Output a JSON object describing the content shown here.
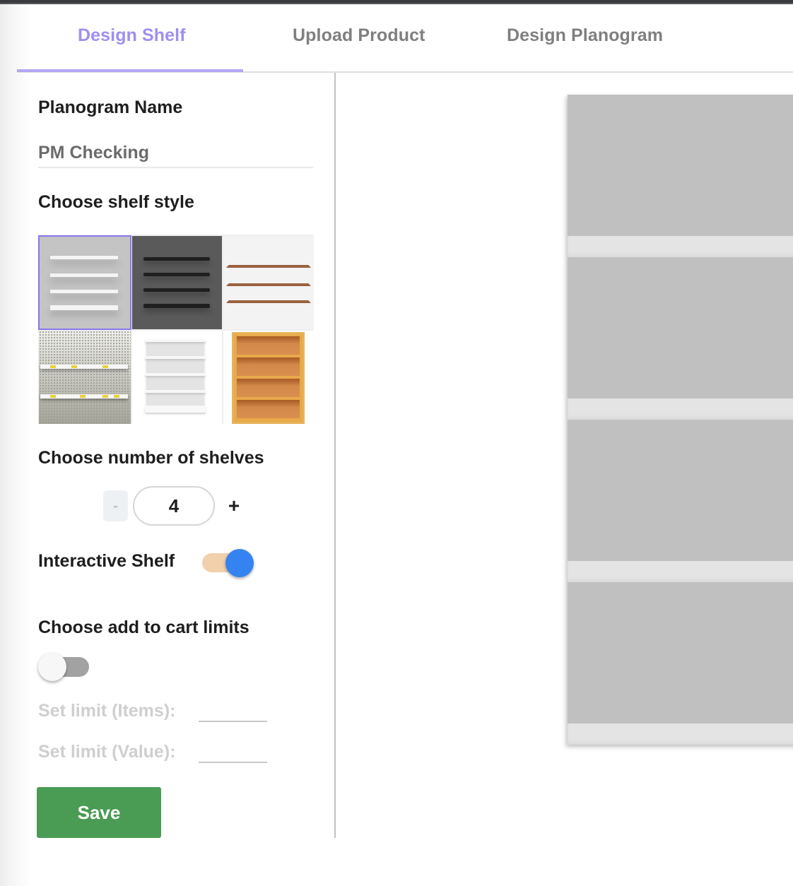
{
  "tabs": [
    {
      "label": "Design Shelf",
      "active": true
    },
    {
      "label": "Upload Product",
      "active": false
    },
    {
      "label": "Design Planogram",
      "active": false
    }
  ],
  "form": {
    "planogram_name_label": "Planogram Name",
    "planogram_name_value": "PM Checking",
    "shelf_style_label": "Choose shelf style",
    "shelf_styles": [
      {
        "name": "white-wall-shelves",
        "selected": true
      },
      {
        "name": "black-wall-shelves",
        "selected": false
      },
      {
        "name": "wooden-floating-shelves",
        "selected": false
      },
      {
        "name": "pegboard-shelves",
        "selected": false
      },
      {
        "name": "white-gondola-shelf",
        "selected": false
      },
      {
        "name": "wooden-bookcase",
        "selected": false
      }
    ],
    "num_shelves_label": "Choose number of shelves",
    "num_shelves": {
      "minus_label": "-",
      "value": "4",
      "plus_label": "+"
    },
    "interactive_shelf_label": "Interactive Shelf",
    "interactive_shelf_on": true,
    "cart_limits_label": "Choose add to cart limits",
    "cart_limits_on": false,
    "limit_items_label": "Set limit (Items):",
    "limit_items_value": "",
    "limit_value_label": "Set limit (Value):",
    "limit_value_value": "",
    "save_label": "Save"
  },
  "preview": {
    "shelf_count": 4
  },
  "colors": {
    "accent": "#a08ff0",
    "tab_indicator": "#b4a6f3",
    "toggle_on_knob": "#3583f0",
    "toggle_on_track": "#f2d0ac",
    "save_button": "#4a9b54",
    "shelf_bay": "#c0c0c0",
    "shelf_board": "#e4e4e4"
  }
}
